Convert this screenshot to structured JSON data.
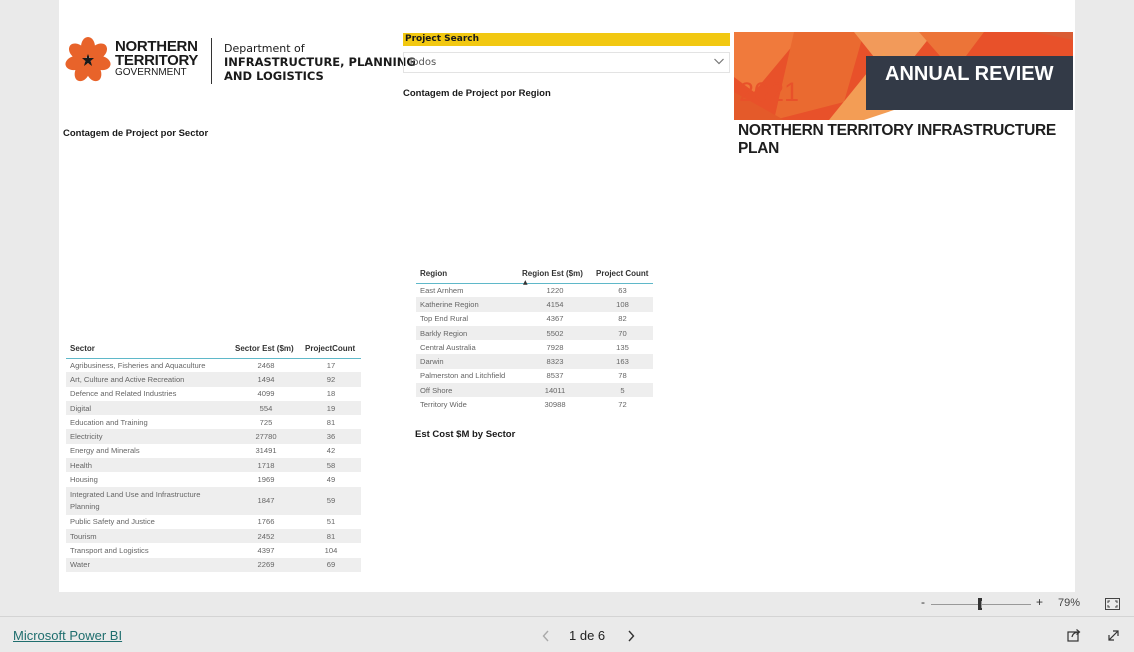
{
  "logo": {
    "brand_line1": "NORTHERN",
    "brand_line2": "TERRITORY",
    "brand_line3": "GOVERNMENT",
    "dept_line1": "Department of",
    "dept_line2": "INFRASTRUCTURE, PLANNING",
    "dept_line3": "AND LOGISTICS"
  },
  "slicer": {
    "title": "Project Search",
    "value": "Todos"
  },
  "visuals": {
    "region_count_title": "Contagem de Project por Region",
    "sector_count_title": "Contagem de Project por Sector",
    "est_cost_title": "Est Cost $M by Sector"
  },
  "banner": {
    "badge": "ANNUAL REVIEW",
    "year": "2021",
    "title": "NORTHERN TERRITORY INFRASTRUCTURE PLAN"
  },
  "sector_table": {
    "headers": [
      "Sector",
      "Sector Est ($m)",
      "ProjectCount"
    ],
    "rows": [
      [
        "Agribusiness, Fisheries and Aquaculture",
        "2468",
        "17"
      ],
      [
        "Art, Culture and Active Recreation",
        "1494",
        "92"
      ],
      [
        "Defence and Related Industries",
        "4099",
        "18"
      ],
      [
        "Digital",
        "554",
        "19"
      ],
      [
        "Education and Training",
        "725",
        "81"
      ],
      [
        "Electricity",
        "27780",
        "36"
      ],
      [
        "Energy and Minerals",
        "31491",
        "42"
      ],
      [
        "Health",
        "1718",
        "58"
      ],
      [
        "Housing",
        "1969",
        "49"
      ],
      [
        "Integrated Land Use and Infrastructure Planning",
        "1847",
        "59"
      ],
      [
        "Public Safety and Justice",
        "1766",
        "51"
      ],
      [
        "Tourism",
        "2452",
        "81"
      ],
      [
        "Transport and Logistics",
        "4397",
        "104"
      ],
      [
        "Water",
        "2269",
        "69"
      ]
    ]
  },
  "region_table": {
    "headers": [
      "Region",
      "Region Est ($m)",
      "Project Count"
    ],
    "rows": [
      [
        "East Arnhem",
        "1220",
        "63"
      ],
      [
        "Katherine Region",
        "4154",
        "108"
      ],
      [
        "Top End Rural",
        "4367",
        "82"
      ],
      [
        "Barkly Region",
        "5502",
        "70"
      ],
      [
        "Central Australia",
        "7928",
        "135"
      ],
      [
        "Darwin",
        "8323",
        "163"
      ],
      [
        "Palmerston and Litchfield",
        "8537",
        "78"
      ],
      [
        "Off Shore",
        "14011",
        "5"
      ],
      [
        "Territory Wide",
        "30988",
        "72"
      ]
    ]
  },
  "zoom": {
    "minus": "-",
    "plus": "+",
    "level": "79%",
    "level_fraction": 0.79
  },
  "footer": {
    "powerbi_link": "Microsoft Power BI",
    "page_indicator": "1 de 6"
  },
  "colors": {
    "accent_yellow": "#f2c811",
    "banner_orange": "#e8512a",
    "table_rule": "#5fb8c9",
    "link": "#1f6e6e"
  }
}
